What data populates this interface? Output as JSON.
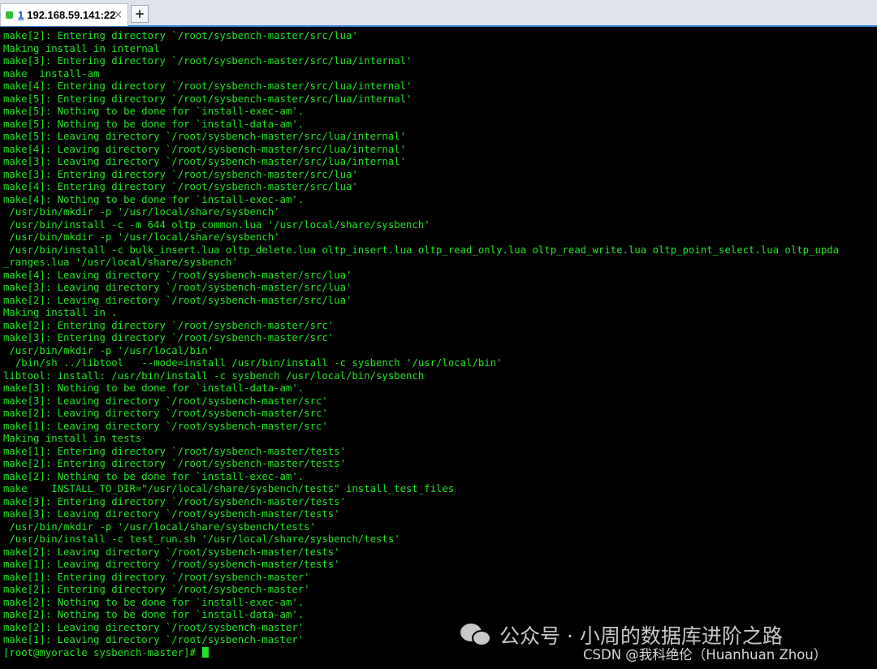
{
  "tab": {
    "index": "1",
    "title": "192.168.59.141:22",
    "close": "×",
    "new_tab": "+"
  },
  "colors": {
    "terminal_bg": "#000000",
    "terminal_fg": "#23e323",
    "tab_status": "#2fbf3a"
  },
  "terminal": {
    "lines": [
      "make[2]: Entering directory `/root/sysbench-master/src/lua'",
      "Making install in internal",
      "make[3]: Entering directory `/root/sysbench-master/src/lua/internal'",
      "make  install-am",
      "make[4]: Entering directory `/root/sysbench-master/src/lua/internal'",
      "make[5]: Entering directory `/root/sysbench-master/src/lua/internal'",
      "make[5]: Nothing to be done for `install-exec-am'.",
      "make[5]: Nothing to be done for `install-data-am'.",
      "make[5]: Leaving directory `/root/sysbench-master/src/lua/internal'",
      "make[4]: Leaving directory `/root/sysbench-master/src/lua/internal'",
      "make[3]: Leaving directory `/root/sysbench-master/src/lua/internal'",
      "make[3]: Entering directory `/root/sysbench-master/src/lua'",
      "make[4]: Entering directory `/root/sysbench-master/src/lua'",
      "make[4]: Nothing to be done for `install-exec-am'.",
      " /usr/bin/mkdir -p '/usr/local/share/sysbench'",
      " /usr/bin/install -c -m 644 oltp_common.lua '/usr/local/share/sysbench'",
      " /usr/bin/mkdir -p '/usr/local/share/sysbench'",
      " /usr/bin/install -c bulk_insert.lua oltp_delete.lua oltp_insert.lua oltp_read_only.lua oltp_read_write.lua oltp_point_select.lua oltp_upda",
      "_ranges.lua '/usr/local/share/sysbench'",
      "make[4]: Leaving directory `/root/sysbench-master/src/lua'",
      "make[3]: Leaving directory `/root/sysbench-master/src/lua'",
      "make[2]: Leaving directory `/root/sysbench-master/src/lua'",
      "Making install in .",
      "make[2]: Entering directory `/root/sysbench-master/src'",
      "make[3]: Entering directory `/root/sysbench-master/src'",
      " /usr/bin/mkdir -p '/usr/local/bin'",
      "  /bin/sh ../libtool   --mode=install /usr/bin/install -c sysbench '/usr/local/bin'",
      "libtool: install: /usr/bin/install -c sysbench /usr/local/bin/sysbench",
      "make[3]: Nothing to be done for `install-data-am'.",
      "make[3]: Leaving directory `/root/sysbench-master/src'",
      "make[2]: Leaving directory `/root/sysbench-master/src'",
      "make[1]: Leaving directory `/root/sysbench-master/src'",
      "Making install in tests",
      "make[1]: Entering directory `/root/sysbench-master/tests'",
      "make[2]: Entering directory `/root/sysbench-master/tests'",
      "make[2]: Nothing to be done for `install-exec-am'.",
      "make    INSTALL_TO_DIR=\"/usr/local/share/sysbench/tests\" install_test_files",
      "make[3]: Entering directory `/root/sysbench-master/tests'",
      "make[3]: Leaving directory `/root/sysbench-master/tests'",
      " /usr/bin/mkdir -p '/usr/local/share/sysbench/tests'",
      " /usr/bin/install -c test_run.sh '/usr/local/share/sysbench/tests'",
      "make[2]: Leaving directory `/root/sysbench-master/tests'",
      "make[1]: Leaving directory `/root/sysbench-master/tests'",
      "make[1]: Entering directory `/root/sysbench-master'",
      "make[2]: Entering directory `/root/sysbench-master'",
      "make[2]: Nothing to be done for `install-exec-am'.",
      "make[2]: Nothing to be done for `install-data-am'.",
      "make[2]: Leaving directory `/root/sysbench-master'",
      "make[1]: Leaving directory `/root/sysbench-master'"
    ],
    "prompt": "[root@myoracle sysbench-master]# "
  },
  "watermark": {
    "text": "公众号 · 小周的数据库进阶之路",
    "icon": "wechat-icon"
  },
  "credit": {
    "text": "CSDN @我科绝伦（Huanhuan Zhou）"
  }
}
